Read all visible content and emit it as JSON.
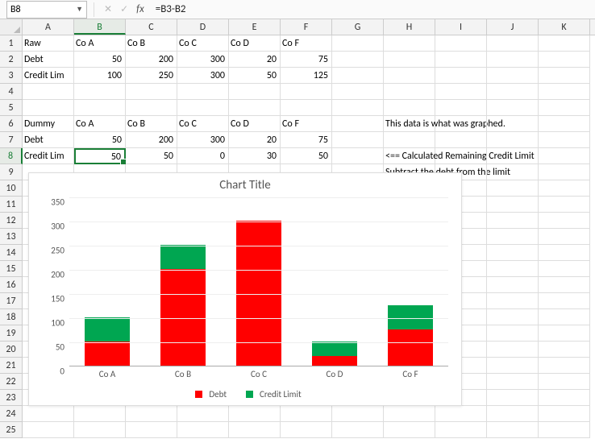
{
  "namebox": "B8",
  "formula": "=B3-B2",
  "columns": [
    "A",
    "B",
    "C",
    "D",
    "E",
    "F",
    "G",
    "H",
    "I",
    "J",
    "K"
  ],
  "selected_col_index": 1,
  "selected_row_index": 7,
  "rows": [
    {
      "r": "1",
      "cells": [
        {
          "t": "txt",
          "v": "Raw"
        },
        {
          "t": "txt",
          "v": "Co A"
        },
        {
          "t": "txt",
          "v": "Co B"
        },
        {
          "t": "txt",
          "v": "Co C"
        },
        {
          "t": "txt",
          "v": "Co D"
        },
        {
          "t": "txt",
          "v": "Co F"
        },
        {},
        {},
        {},
        {},
        {}
      ]
    },
    {
      "r": "2",
      "cells": [
        {
          "t": "txt",
          "v": "Debt"
        },
        {
          "t": "num",
          "v": "50"
        },
        {
          "t": "num",
          "v": "200"
        },
        {
          "t": "num",
          "v": "300"
        },
        {
          "t": "num",
          "v": "20"
        },
        {
          "t": "num",
          "v": "75"
        },
        {},
        {},
        {},
        {},
        {}
      ]
    },
    {
      "r": "3",
      "cells": [
        {
          "t": "txt",
          "v": "Credit Lim"
        },
        {
          "t": "num",
          "v": "100"
        },
        {
          "t": "num",
          "v": "250"
        },
        {
          "t": "num",
          "v": "300"
        },
        {
          "t": "num",
          "v": "50"
        },
        {
          "t": "num",
          "v": "125"
        },
        {},
        {},
        {},
        {},
        {}
      ]
    },
    {
      "r": "4",
      "cells": [
        {},
        {},
        {},
        {},
        {},
        {},
        {},
        {},
        {},
        {},
        {}
      ]
    },
    {
      "r": "5",
      "cells": [
        {},
        {},
        {},
        {},
        {},
        {},
        {},
        {},
        {},
        {},
        {}
      ]
    },
    {
      "r": "6",
      "cells": [
        {
          "t": "txt",
          "v": "Dummy"
        },
        {
          "t": "txt",
          "v": "Co A"
        },
        {
          "t": "txt",
          "v": "Co B"
        },
        {
          "t": "txt",
          "v": "Co C"
        },
        {
          "t": "txt",
          "v": "Co D"
        },
        {
          "t": "txt",
          "v": "Co F"
        },
        {},
        {
          "t": "txt",
          "v": "This data is what was graphed.",
          "overflow": true
        },
        {},
        {},
        {}
      ]
    },
    {
      "r": "7",
      "cells": [
        {
          "t": "txt",
          "v": "Debt"
        },
        {
          "t": "num",
          "v": "50"
        },
        {
          "t": "num",
          "v": "200"
        },
        {
          "t": "num",
          "v": "300"
        },
        {
          "t": "num",
          "v": "20"
        },
        {
          "t": "num",
          "v": "75"
        },
        {},
        {},
        {},
        {},
        {}
      ]
    },
    {
      "r": "8",
      "cells": [
        {
          "t": "txt",
          "v": "Credit Lim"
        },
        {
          "t": "num",
          "v": "50",
          "selected": true
        },
        {
          "t": "num",
          "v": "50"
        },
        {
          "t": "num",
          "v": "0"
        },
        {
          "t": "num",
          "v": "30"
        },
        {
          "t": "num",
          "v": "50"
        },
        {},
        {
          "t": "txt",
          "v": "<== Calculated Remaining Credit Limit",
          "overflow": true
        },
        {},
        {},
        {}
      ]
    },
    {
      "r": "9",
      "cells": [
        {},
        {},
        {},
        {},
        {},
        {},
        {},
        {
          "t": "txt",
          "v": "Subtract the debt from the limit",
          "overflow": true
        },
        {},
        {},
        {}
      ]
    },
    {
      "r": "10",
      "cells": [
        {},
        {},
        {},
        {},
        {},
        {},
        {},
        {},
        {},
        {},
        {}
      ]
    },
    {
      "r": "11",
      "cells": [
        {},
        {},
        {},
        {},
        {},
        {},
        {},
        {},
        {},
        {},
        {}
      ]
    },
    {
      "r": "12",
      "cells": [
        {},
        {},
        {},
        {},
        {},
        {},
        {},
        {},
        {},
        {},
        {}
      ]
    },
    {
      "r": "13",
      "cells": [
        {},
        {},
        {},
        {},
        {},
        {},
        {},
        {},
        {},
        {},
        {}
      ]
    },
    {
      "r": "14",
      "cells": [
        {},
        {},
        {},
        {},
        {},
        {},
        {},
        {},
        {},
        {},
        {}
      ]
    },
    {
      "r": "15",
      "cells": [
        {},
        {},
        {},
        {},
        {},
        {},
        {},
        {},
        {},
        {},
        {}
      ]
    },
    {
      "r": "16",
      "cells": [
        {},
        {},
        {},
        {},
        {},
        {},
        {},
        {},
        {},
        {},
        {}
      ]
    },
    {
      "r": "17",
      "cells": [
        {},
        {},
        {},
        {},
        {},
        {},
        {},
        {},
        {},
        {},
        {}
      ]
    },
    {
      "r": "18",
      "cells": [
        {},
        {},
        {},
        {},
        {},
        {},
        {},
        {},
        {},
        {},
        {}
      ]
    },
    {
      "r": "19",
      "cells": [
        {},
        {},
        {},
        {},
        {},
        {},
        {},
        {},
        {},
        {},
        {}
      ]
    },
    {
      "r": "20",
      "cells": [
        {},
        {},
        {},
        {},
        {},
        {},
        {},
        {},
        {},
        {},
        {}
      ]
    },
    {
      "r": "21",
      "cells": [
        {},
        {},
        {},
        {},
        {},
        {},
        {},
        {},
        {},
        {},
        {}
      ]
    },
    {
      "r": "22",
      "cells": [
        {},
        {},
        {},
        {},
        {},
        {},
        {},
        {},
        {},
        {},
        {}
      ]
    },
    {
      "r": "23",
      "cells": [
        {},
        {},
        {},
        {},
        {},
        {},
        {},
        {},
        {},
        {},
        {}
      ]
    },
    {
      "r": "24",
      "cells": [
        {},
        {},
        {},
        {},
        {},
        {},
        {},
        {},
        {},
        {},
        {}
      ]
    },
    {
      "r": "25",
      "cells": [
        {},
        {},
        {},
        {},
        {},
        {},
        {},
        {},
        {},
        {},
        {}
      ]
    }
  ],
  "chart_data": {
    "type": "bar",
    "stacked": true,
    "title": "Chart Title",
    "ylim": [
      0,
      350
    ],
    "ytick_step": 50,
    "categories": [
      "Co A",
      "Co B",
      "Co C",
      "Co D",
      "Co F"
    ],
    "series": [
      {
        "name": "Debt",
        "color": "#ff0000",
        "values": [
          50,
          200,
          300,
          20,
          75
        ]
      },
      {
        "name": "Credit Limit",
        "color": "#00a651",
        "values": [
          50,
          50,
          0,
          30,
          50
        ]
      }
    ],
    "xlabel": "",
    "ylabel": ""
  }
}
